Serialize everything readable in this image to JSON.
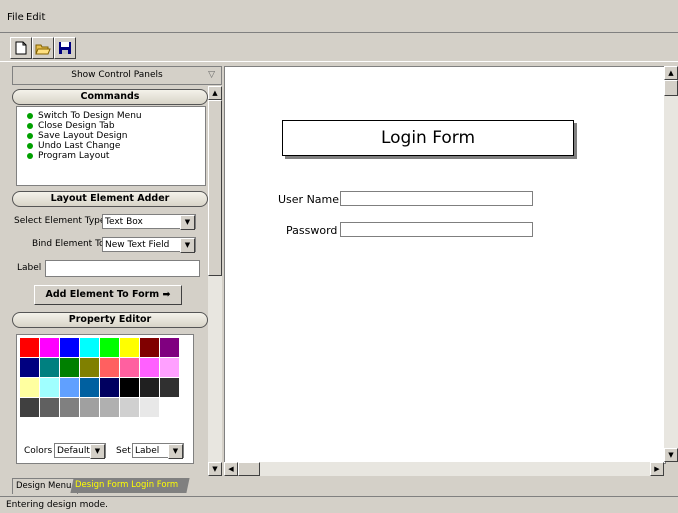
{
  "menu": {
    "file": "File",
    "edit": "Edit"
  },
  "panel": {
    "show_label": "Show Control Panels",
    "commands": {
      "header": "Commands",
      "items": [
        "Switch To Design Menu",
        "Close Design Tab",
        "Save Layout Design",
        "Undo Last Change",
        "Program Layout"
      ]
    },
    "adder": {
      "header": "Layout Element Adder",
      "type_label": "Select Element Type",
      "type_value": "Text Box",
      "bind_label": "Bind Element To",
      "bind_value": "New Text Field",
      "label_label": "Label",
      "label_value": "",
      "add_button": "Add Element To Form"
    },
    "property": {
      "header": "Property Editor",
      "colors_label": "Colors",
      "colors_value": "Default",
      "set_label": "Set",
      "set_value": "Label",
      "swatches": [
        "#ff0000",
        "#ff00ff",
        "#0000ff",
        "#00ffff",
        "#00ff00",
        "#ffff00",
        "#800000",
        "#800080",
        "#000080",
        "#008080",
        "#008000",
        "#808000",
        "#ff6060",
        "#ff60a0",
        "#ff60ff",
        "#ffa0ff",
        "#ffffa0",
        "#a0ffff",
        "#60a0ff",
        "#0060a0",
        "#000060",
        "#000000",
        "#202020",
        "#303030",
        "#404040",
        "#606060",
        "#808080",
        "#a0a0a0",
        "#b0b0b0",
        "#d0d0d0",
        "#e8e8e8",
        "#ffffff"
      ]
    }
  },
  "form": {
    "title": "Login Form",
    "username_label": "User Name",
    "password_label": "Password"
  },
  "tabs": [
    "Design Menu",
    "Design Form Login Form"
  ],
  "status": "Entering design mode.",
  "colors": {
    "active_tab_text": "#ffff00",
    "tab_bg": "#808080",
    "bullet": "#00a000"
  }
}
